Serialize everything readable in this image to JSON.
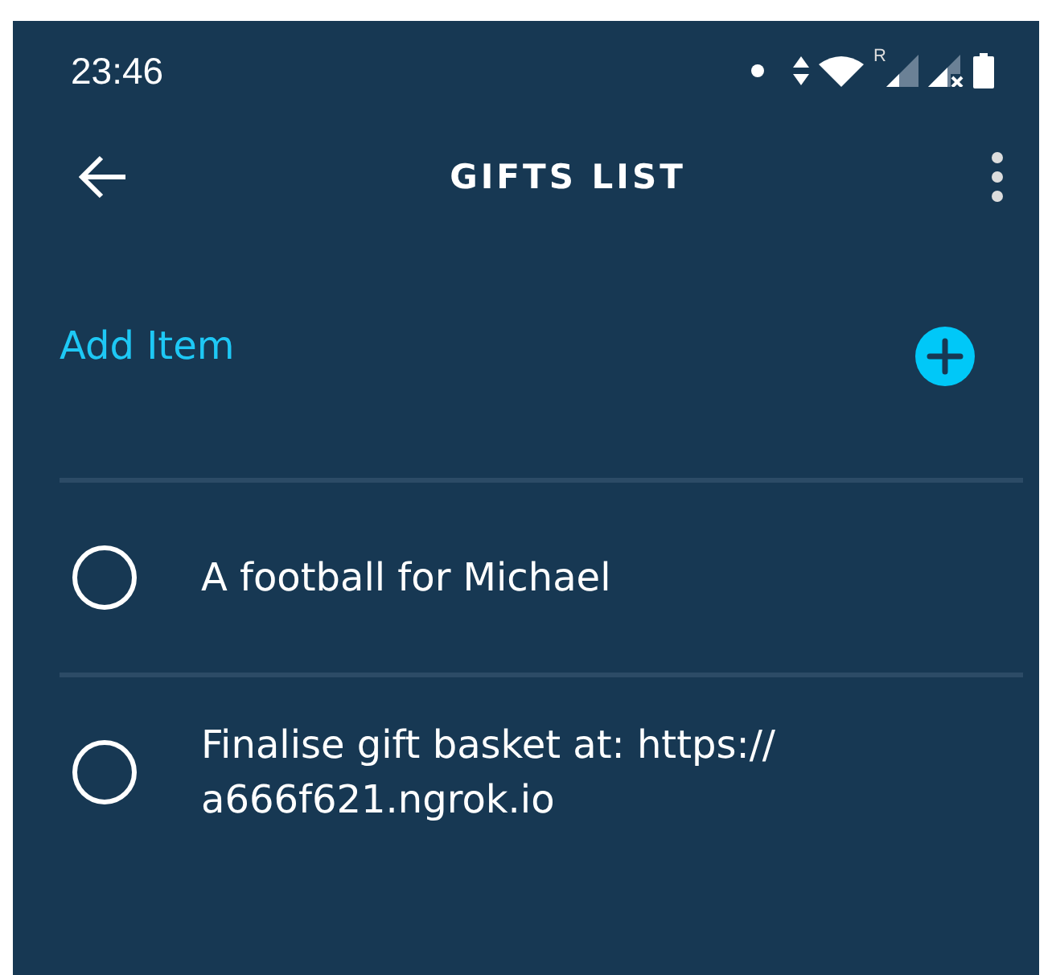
{
  "status_bar": {
    "time": "23:46",
    "roaming": "R"
  },
  "app_bar": {
    "title": "GIFTS LIST"
  },
  "add_item": {
    "label": "Add Item"
  },
  "items": [
    {
      "text": "A football for Michael",
      "checked": false
    },
    {
      "text": "Finalise gift basket at: https:// a666f621.ngrok.io",
      "checked": false
    }
  ]
}
